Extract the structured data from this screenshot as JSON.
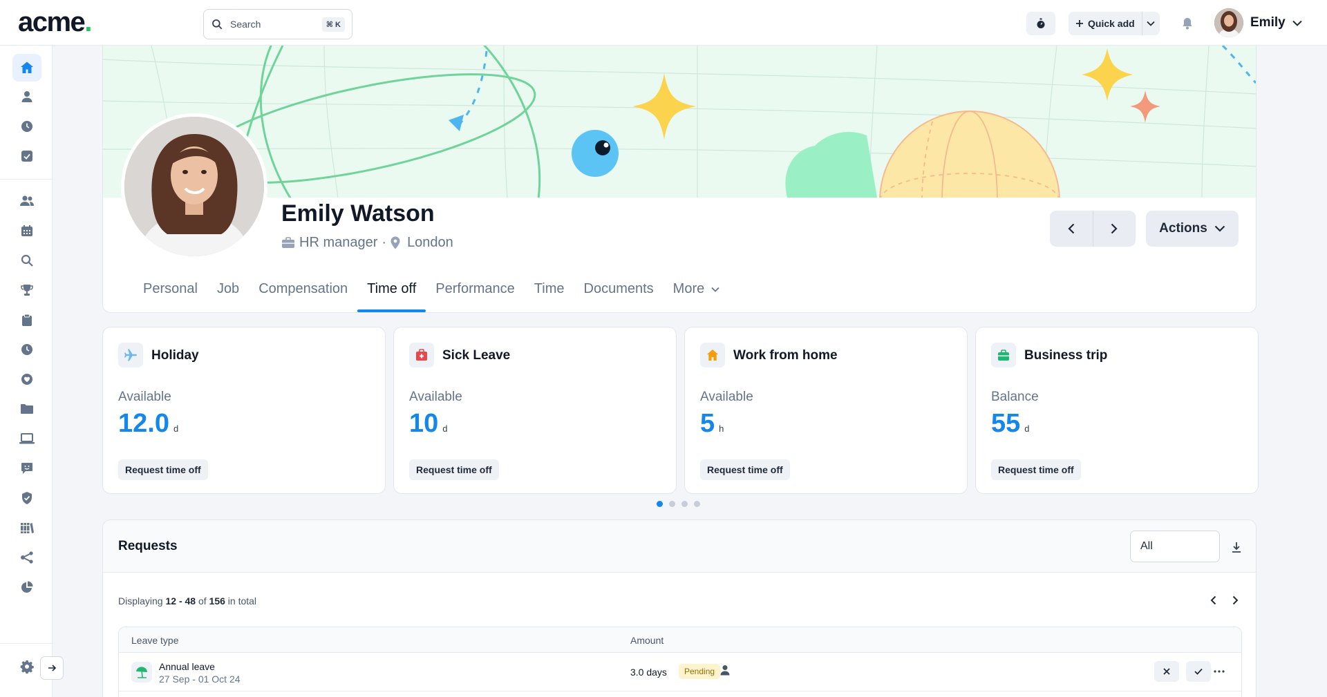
{
  "app": {
    "logo_text": "acme",
    "logo_dot": ".",
    "brand_color": "#22c55e",
    "accent_color": "#1586ec"
  },
  "topbar": {
    "search_placeholder": "Search",
    "search_shortcut": "⌘ K",
    "quick_add_label": "Quick add",
    "user_name": "Emily",
    "icons": [
      "search-icon",
      "timer-icon",
      "plus-icon",
      "chevron-down-icon",
      "bell-icon"
    ]
  },
  "sidebar": {
    "items": [
      {
        "icon": "home-icon",
        "active": true
      },
      {
        "icon": "person-icon"
      },
      {
        "icon": "clock-icon"
      },
      {
        "icon": "checkbox-icon"
      },
      {
        "icon": "people-icon"
      },
      {
        "icon": "calendar-icon"
      },
      {
        "icon": "search-icon"
      },
      {
        "icon": "trophy-icon"
      },
      {
        "icon": "clipboard-icon"
      },
      {
        "icon": "clock-icon"
      },
      {
        "icon": "heart-icon"
      },
      {
        "icon": "folder-icon"
      },
      {
        "icon": "laptop-icon"
      },
      {
        "icon": "chat-icon"
      },
      {
        "icon": "shield-icon"
      },
      {
        "icon": "books-icon"
      },
      {
        "icon": "share-icon"
      },
      {
        "icon": "pie-chart-icon"
      }
    ],
    "settings_icon": "gear-icon",
    "collapse_icon": "arrow-right-icon"
  },
  "profile": {
    "name": "Emily Watson",
    "role": "HR manager",
    "separator": "·",
    "location": "London",
    "actions_label": "Actions"
  },
  "tabs": [
    {
      "label": "Personal"
    },
    {
      "label": "Job"
    },
    {
      "label": "Compensation"
    },
    {
      "label": "Time off",
      "active": true
    },
    {
      "label": "Performance"
    },
    {
      "label": "Time"
    },
    {
      "label": "Documents"
    },
    {
      "label": "More"
    }
  ],
  "balances": [
    {
      "title": "Holiday",
      "icon": "airplane-icon",
      "label": "Available",
      "value": "12.0",
      "unit": "d",
      "button": "Request time off"
    },
    {
      "title": "Sick Leave",
      "icon": "first-aid-icon",
      "label": "Available",
      "value": "10",
      "unit": "d",
      "button": "Request time off"
    },
    {
      "title": "Work from home",
      "icon": "house-icon",
      "label": "Available",
      "value": "5",
      "unit": "h",
      "button": "Request time off"
    },
    {
      "title": "Business trip",
      "icon": "briefcase-icon",
      "label": "Balance",
      "value": "55",
      "unit": "d",
      "button": "Request time off"
    }
  ],
  "carousel": {
    "pages": 4,
    "current": 1
  },
  "requests": {
    "title": "Requests",
    "filter_value": "All",
    "display_prefix": "Displaying",
    "range": "12 - 48",
    "of": "of",
    "total": "156",
    "suffix": "in total",
    "columns": [
      "Leave type",
      "Amount"
    ],
    "rows": [
      {
        "type": "Annual leave",
        "dates": "27 Sep - 01 Oct 24",
        "amount": "3.0 days",
        "status": "Pending",
        "icon": "beach-umbrella-icon"
      }
    ]
  }
}
